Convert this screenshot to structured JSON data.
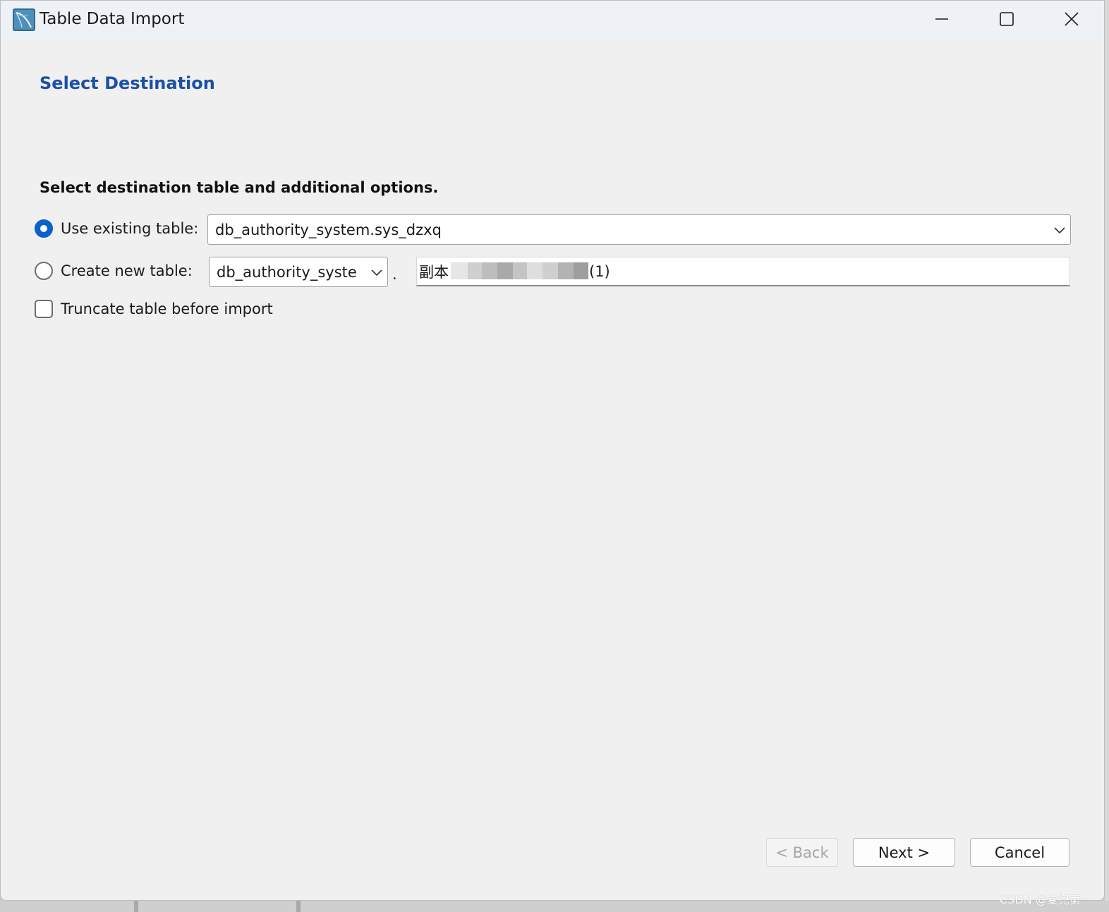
{
  "window": {
    "title": "Table Data Import",
    "controls": {
      "minimize": "minimize-icon",
      "maximize": "maximize-icon",
      "close": "close-icon"
    }
  },
  "page": {
    "title": "Select Destination",
    "instruction": "Select destination table and additional options."
  },
  "options": {
    "use_existing": {
      "label": "Use existing table:",
      "selected": true,
      "value": "db_authority_system.sys_dzxq"
    },
    "create_new": {
      "label": "Create new table:",
      "selected": false,
      "schema_value": "db_authority_syste",
      "separator": ".",
      "table_name_prefix": "副本",
      "table_name_suffix": "(1)",
      "table_name_redacted": true
    },
    "truncate": {
      "label": "Truncate table before import",
      "checked": false
    }
  },
  "buttons": {
    "back": "< Back",
    "next": "Next >",
    "cancel": "Cancel"
  },
  "watermark": "CSDN @麦兜第一",
  "colors": {
    "accent": "#0a63c8",
    "heading": "#1c4fa8",
    "background": "#f0f0f0"
  }
}
